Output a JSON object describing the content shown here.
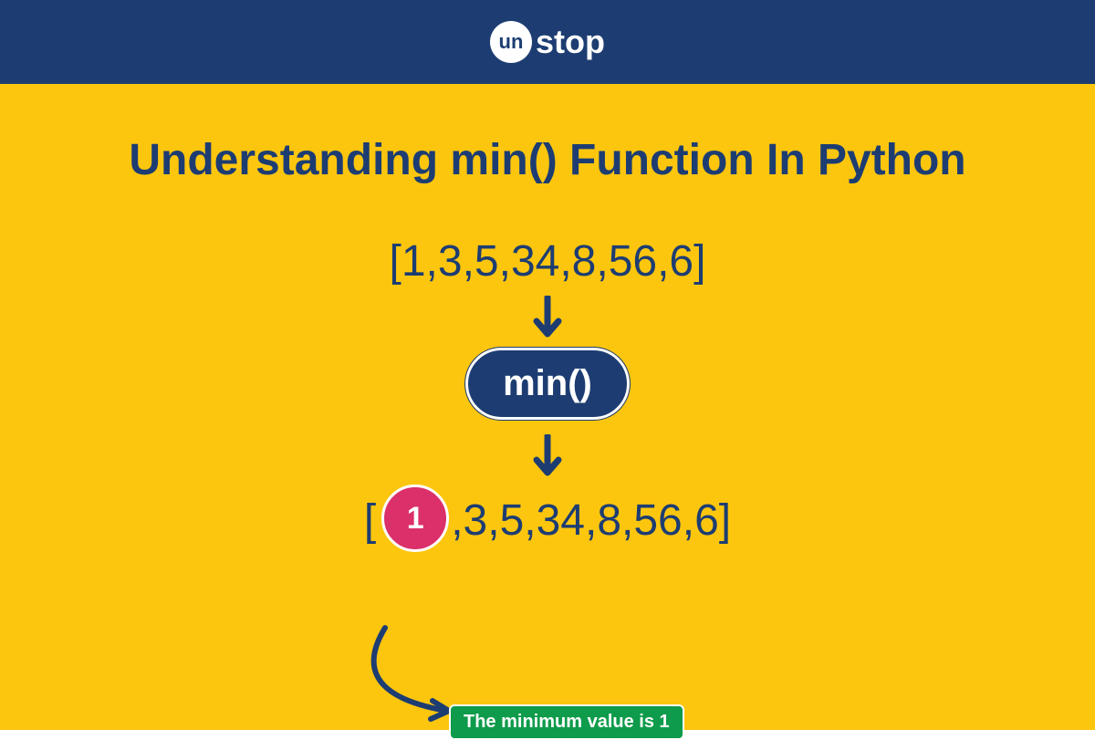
{
  "logo": {
    "circle_text": "un",
    "suffix_text": "stop"
  },
  "title": "Understanding min() Function In Python",
  "input_array": "[1,3,5,34,8,56,6]",
  "function_label": "min()",
  "result": {
    "bracket_open": "[",
    "highlighted_value": "1",
    "rest": ",3,5,34,8,56,6]"
  },
  "caption": "The minimum value is 1",
  "colors": {
    "header_bg": "#1d3d72",
    "content_bg": "#fdc60e",
    "highlight": "#db3069",
    "caption_bg": "#0e9b4b"
  }
}
